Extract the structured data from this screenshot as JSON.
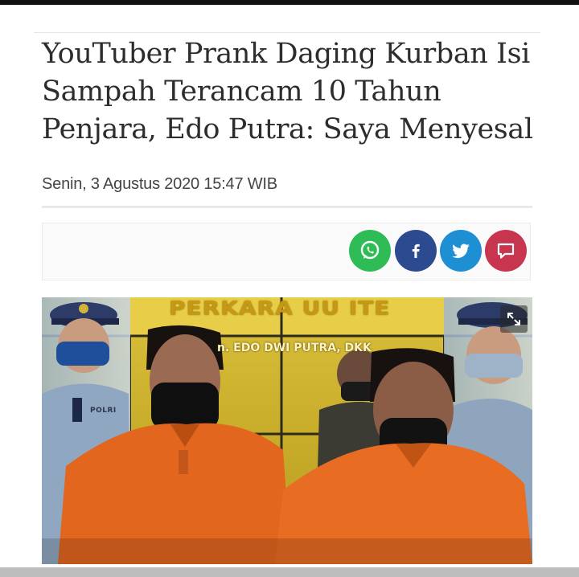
{
  "article": {
    "title": "YouTuber Prank Daging Kurban Isi Sampah Terancam 10 Tahun Penjara, Edo Putra: Saya Menyesal",
    "date": "Senin, 3 Agustus 2020 15:47 WIB"
  },
  "share": {
    "buttons": [
      {
        "name": "whatsapp",
        "icon": "whatsapp-icon",
        "color": "#2fbb56"
      },
      {
        "name": "facebook",
        "icon": "facebook-icon",
        "color": "#2c4a8f"
      },
      {
        "name": "twitter",
        "icon": "twitter-icon",
        "color": "#1f8fd3"
      },
      {
        "name": "comment",
        "icon": "comment-icon",
        "color": "#c8354f"
      }
    ]
  },
  "photo": {
    "banner_title": "PERKARA UU ITE",
    "banner_subtitle": "n. EDO DWI PUTRA, DKK",
    "uniform_badge": "POLRI",
    "expand_icon": "expand-icon"
  }
}
